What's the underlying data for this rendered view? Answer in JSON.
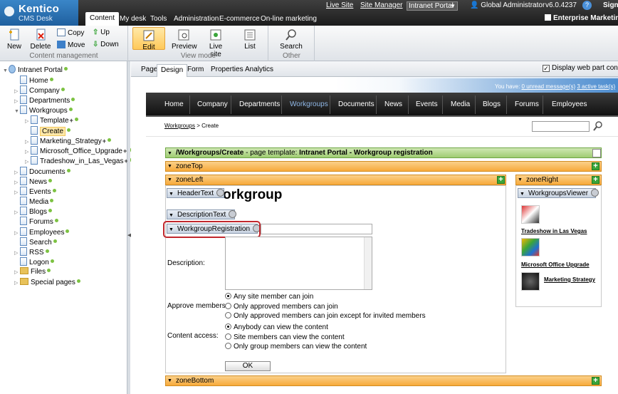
{
  "header": {
    "logo_title": "Kentico",
    "logo_sub": "CMS Desk",
    "tabs": [
      "Content",
      "My desk",
      "Tools",
      "Administration",
      "E-commerce",
      "On-line marketing"
    ],
    "live_site_link": "Live Site",
    "site_manager_link": "Site Manager",
    "site_selector": "Intranet Portal",
    "user": "Global Administrator",
    "version": "v6.0.4237",
    "sign_out": "Sign",
    "ems": "Enterprise Marketing So"
  },
  "toolbar": {
    "new": "New",
    "delete": "Delete",
    "copy": "Copy",
    "move": "Move",
    "up": "Up",
    "down": "Down",
    "group_content": "Content management",
    "edit": "Edit",
    "preview": "Preview",
    "live_site": "Live site",
    "list": "List",
    "group_view": "View mode",
    "search": "Search",
    "group_other": "Other"
  },
  "tree": {
    "root": "Intranet Portal",
    "items": [
      "Home",
      "Company",
      "Departments",
      "Workgroups",
      "Template",
      "Create",
      "Marketing_Strategy",
      "Microsoft_Office_Upgrade",
      "Tradeshow_in_Las_Vegas",
      "Documents",
      "News",
      "Events",
      "Media",
      "Blogs",
      "Forums",
      "Employees",
      "Search",
      "RSS",
      "Logon",
      "Files",
      "Special pages"
    ]
  },
  "page_tabs": [
    "Page",
    "Design",
    "Form",
    "Properties",
    "Analytics"
  ],
  "display_web_part_content": "Display web part content",
  "site": {
    "you_have": "You have:",
    "unread": "0 unread message(s)",
    "tasks": "3 active task(s)",
    "nav": [
      "Home",
      "Company",
      "Departments",
      "Workgroups",
      "Documents",
      "News",
      "Events",
      "Media",
      "Blogs",
      "Forums",
      "Employees"
    ],
    "breadcrumb_link": "Workgroups",
    "breadcrumb_rest": " > Create"
  },
  "design": {
    "template_prefix": "/Workgroups/Create",
    "template_mid": " - page template: ",
    "template_name": "Intranet Portal - Workgroup registration",
    "zone_top": "zoneTop",
    "zone_left": "zoneLeft",
    "zone_right": "zoneRight",
    "zone_bottom": "zoneBottom",
    "wp_header": "HeaderText",
    "wp_desc": "DescriptionText",
    "wp_reg": "WorkgroupRegistration",
    "wp_viewer": "WorkgroupsViewer",
    "workgroup_title": "orkgroup",
    "description_label": "Description:",
    "approve_label": "Approve members:",
    "approve_options": [
      "Any site member can join",
      "Only approved members can join",
      "Only approved members can join except for invited members"
    ],
    "access_label": "Content access:",
    "access_options": [
      "Anybody can view the content",
      "Site members can view the content",
      "Only group members can view the content"
    ],
    "ok": "OK",
    "viewer_links": [
      "Tradeshow in Las Vegas",
      "Microsoft Office Upgrade",
      "Marketing Strategy"
    ]
  }
}
